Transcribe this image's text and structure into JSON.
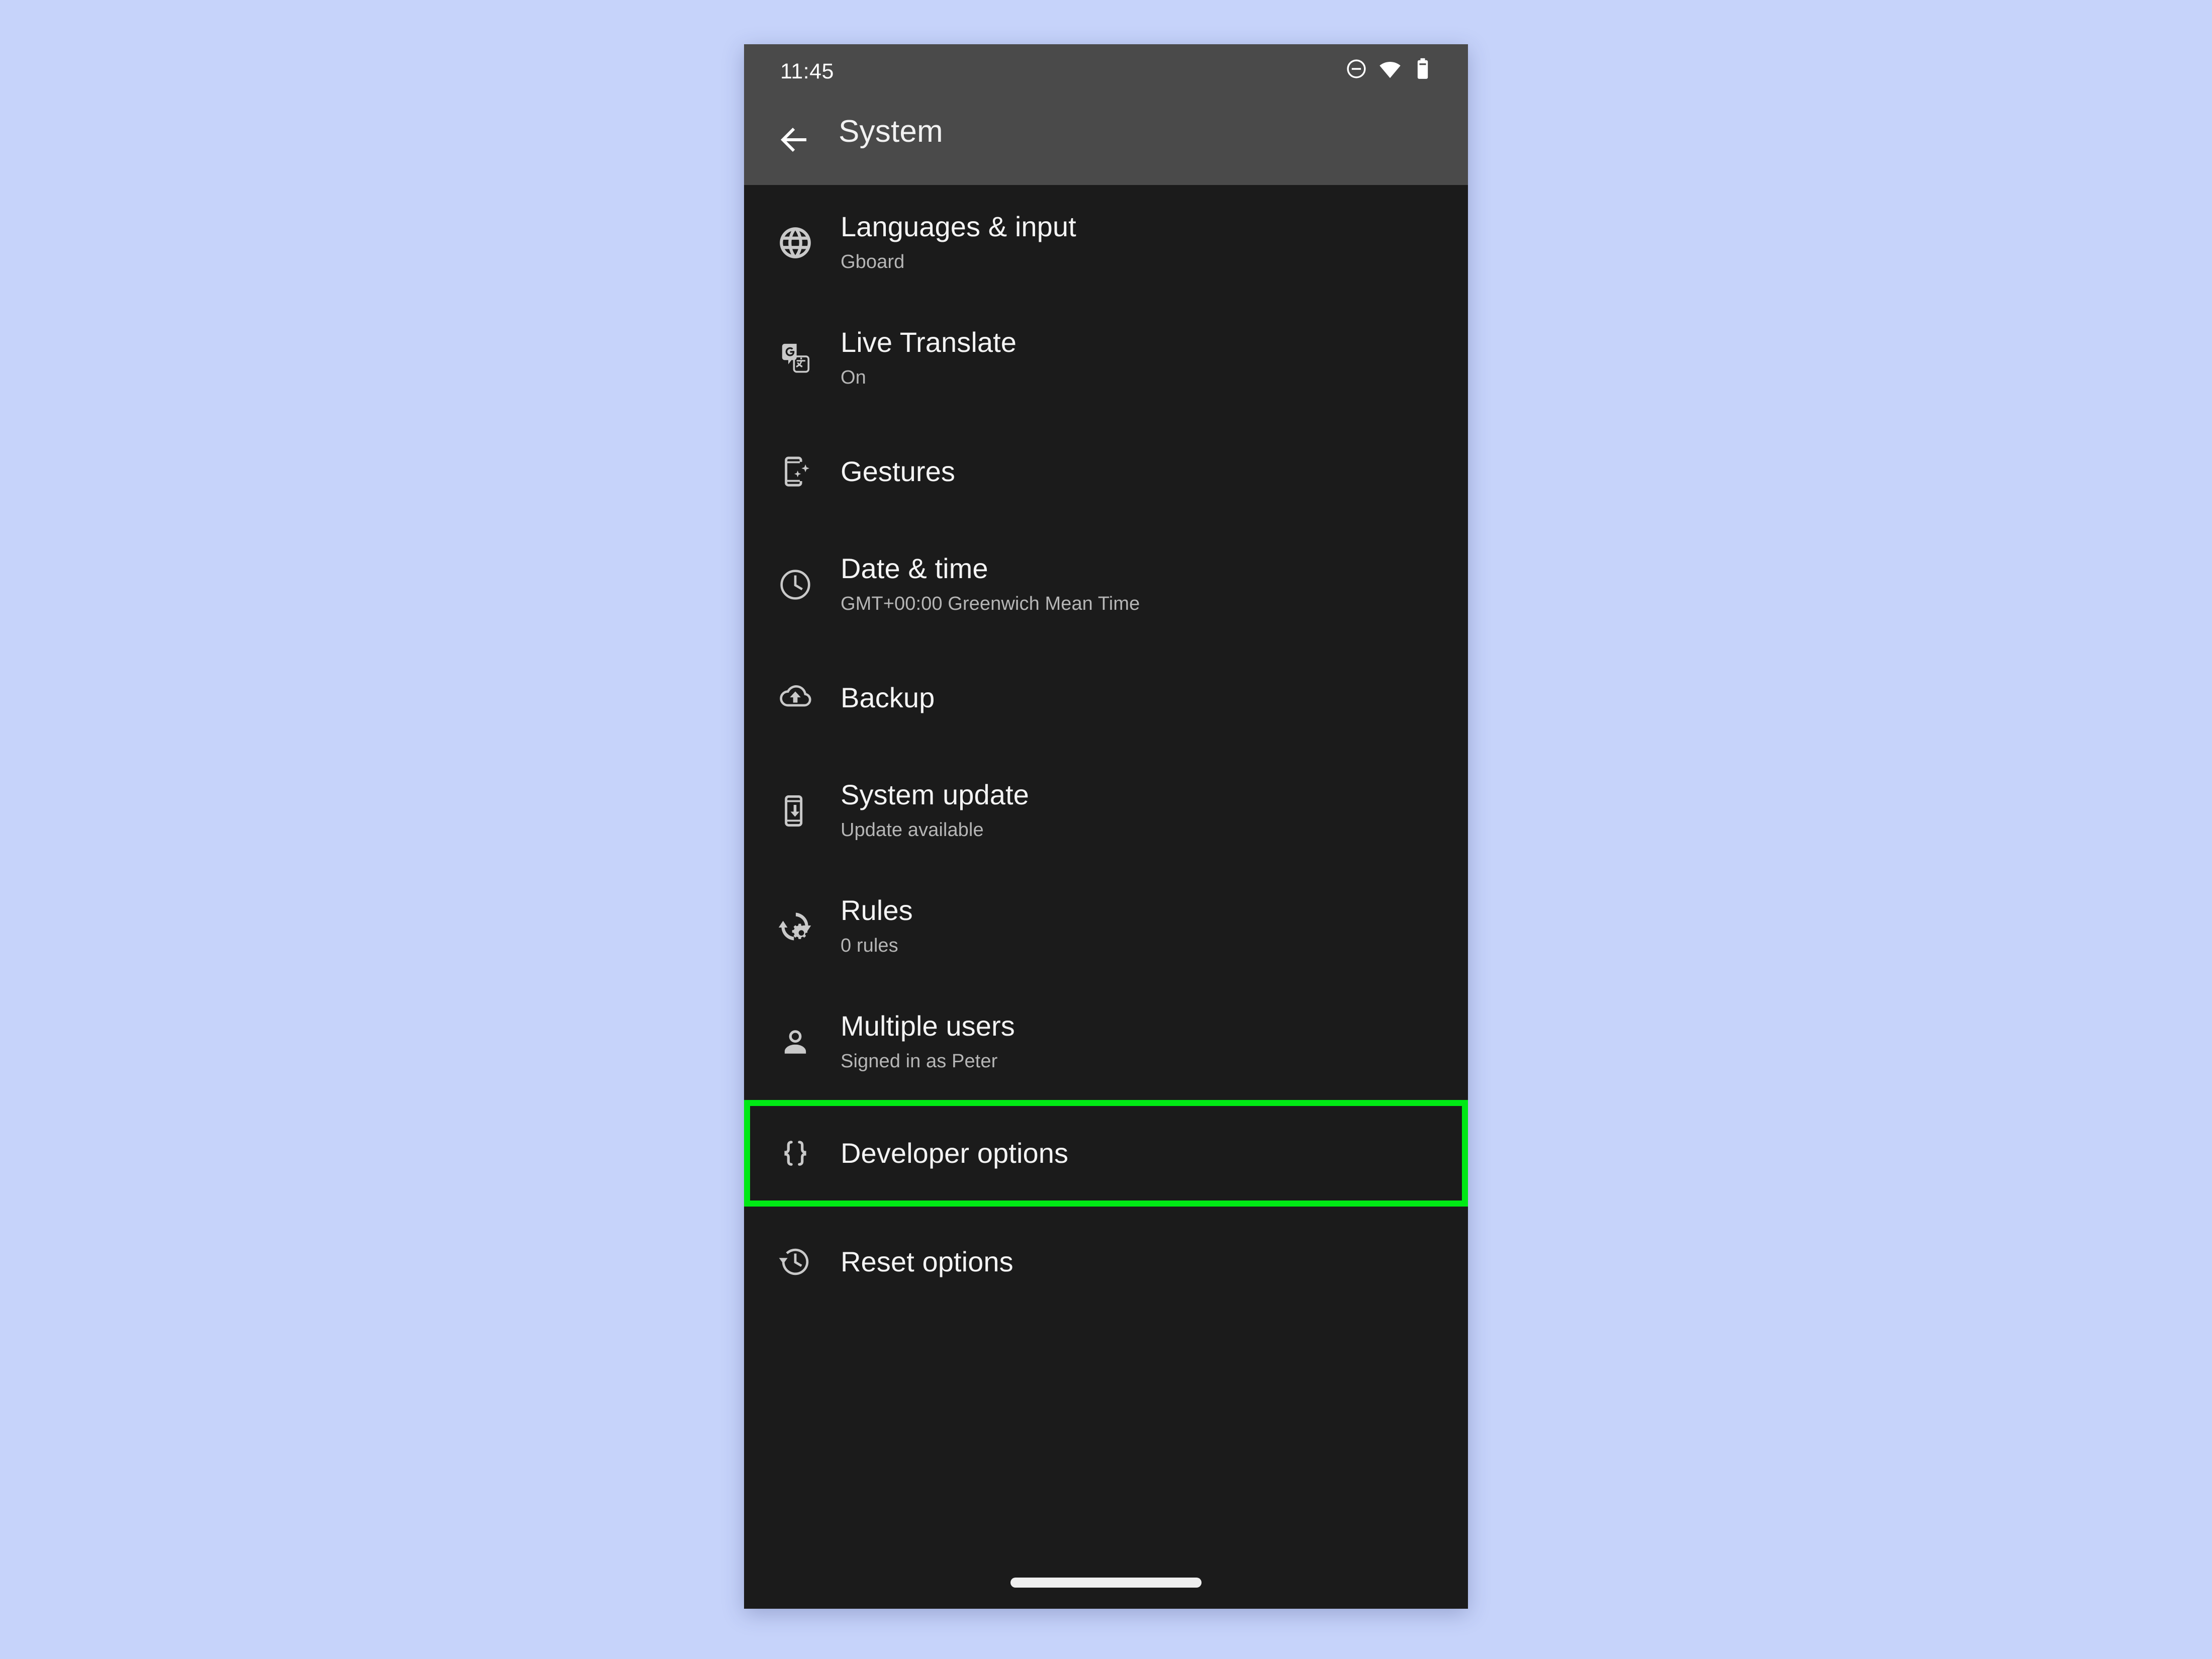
{
  "background_color": "#c6d3fa",
  "phone": {
    "screen_bg": "#1b1b1b",
    "appbar_bg": "#4a4a4a"
  },
  "status_bar": {
    "time": "11:45",
    "icons": [
      {
        "name": "do-not-disturb-icon",
        "glyph": "dnd"
      },
      {
        "name": "wifi-icon",
        "glyph": "wifi"
      },
      {
        "name": "battery-icon",
        "glyph": "battery"
      }
    ]
  },
  "appbar": {
    "back_label": "Back",
    "title": "System"
  },
  "highlight": {
    "color": "#00e915",
    "target": "Developer options"
  },
  "list": {
    "items": [
      {
        "icon": "globe-icon",
        "title": "Languages & input",
        "subtitle": "Gboard",
        "highlighted": false
      },
      {
        "icon": "translate-icon",
        "title": "Live Translate",
        "subtitle": "On",
        "highlighted": false
      },
      {
        "icon": "gestures-icon",
        "title": "Gestures",
        "subtitle": "",
        "highlighted": false
      },
      {
        "icon": "clock-icon",
        "title": "Date & time",
        "subtitle": "GMT+00:00 Greenwich Mean Time",
        "highlighted": false
      },
      {
        "icon": "cloud-upload-icon",
        "title": "Backup",
        "subtitle": "",
        "highlighted": false
      },
      {
        "icon": "system-update-icon",
        "title": "System update",
        "subtitle": "Update available",
        "highlighted": false
      },
      {
        "icon": "rules-icon",
        "title": "Rules",
        "subtitle": "0 rules",
        "highlighted": false
      },
      {
        "icon": "person-icon",
        "title": "Multiple users",
        "subtitle": "Signed in as Peter",
        "highlighted": false
      },
      {
        "icon": "braces-icon",
        "title": "Developer options",
        "subtitle": "",
        "highlighted": true
      },
      {
        "icon": "history-icon",
        "title": "Reset options",
        "subtitle": "",
        "highlighted": false
      }
    ]
  },
  "nav": {
    "home_indicator_label": "Home gesture bar"
  }
}
